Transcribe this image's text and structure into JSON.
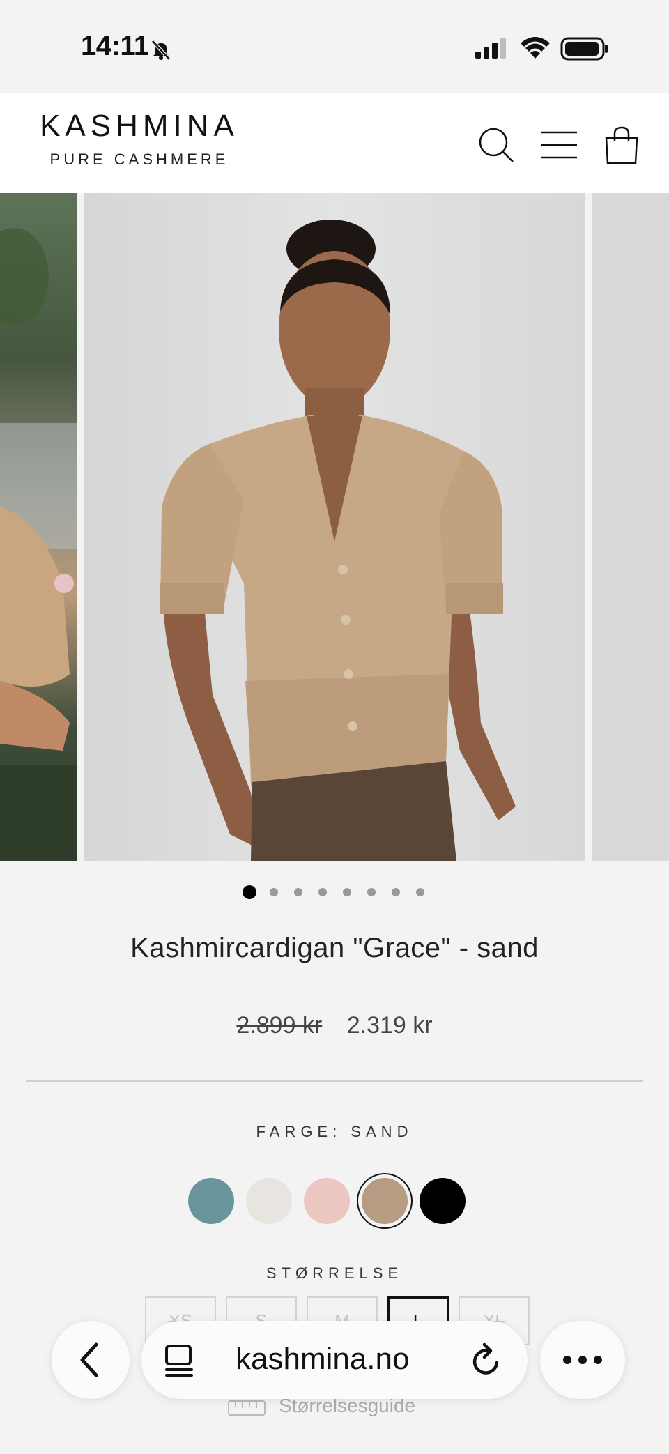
{
  "status_bar": {
    "time": "14:11"
  },
  "header": {
    "logo_main": "KASHMINA",
    "logo_sub": "PURE CASHMERE",
    "icons": [
      "search-icon",
      "menu-icon",
      "bag-icon"
    ]
  },
  "gallery": {
    "slide_count": 8,
    "active_index": 0
  },
  "product": {
    "title": "Kashmircardigan \"Grace\" - sand",
    "price_old": "2.899 kr",
    "price_new": "2.319 kr",
    "color_label": "FARGE: SAND",
    "colors": [
      {
        "name": "teal",
        "hex": "#6a959d"
      },
      {
        "name": "cream",
        "hex": "#e8e4e0"
      },
      {
        "name": "pink",
        "hex": "#ecc6c0"
      },
      {
        "name": "sand",
        "hex": "#b59c82",
        "selected": true
      },
      {
        "name": "black",
        "hex": "#000000"
      }
    ],
    "size_label": "STØRRELSE",
    "sizes": [
      {
        "label": "XS",
        "available": false
      },
      {
        "label": "S",
        "available": false
      },
      {
        "label": "M",
        "available": false
      },
      {
        "label": "L",
        "available": true,
        "selected": true
      },
      {
        "label": "XL",
        "available": false
      }
    ],
    "size_guide": "Størrelsesguide"
  },
  "browser": {
    "url": "kashmina.no"
  }
}
